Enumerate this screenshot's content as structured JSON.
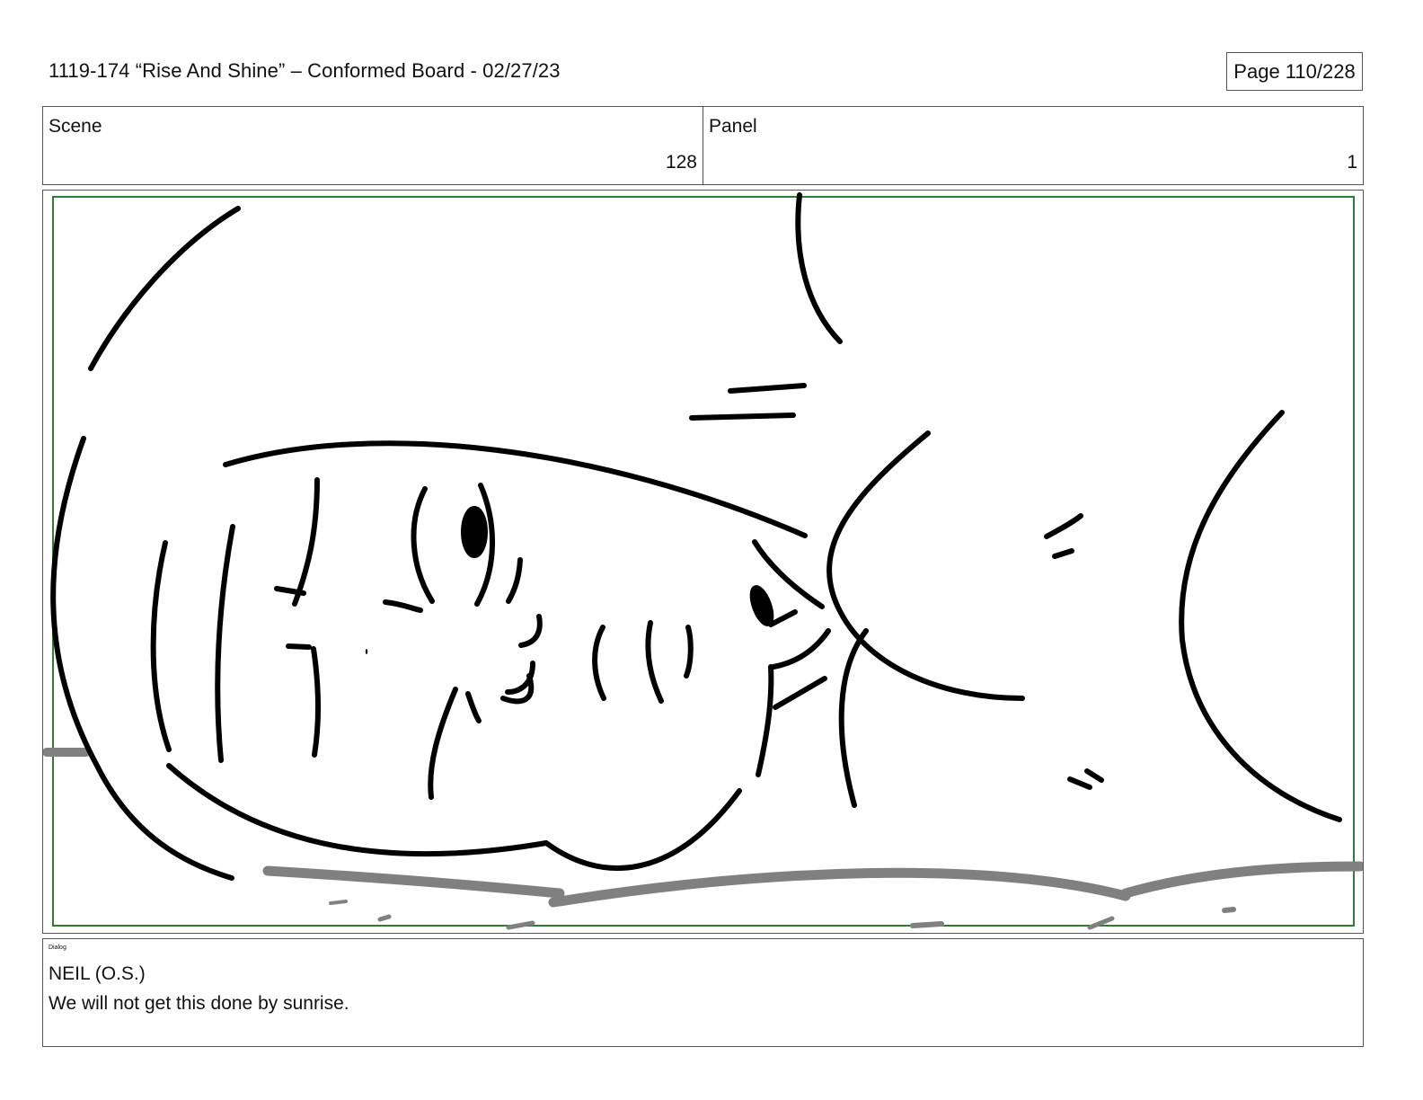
{
  "header": {
    "title": "1119-174 “Rise And Shine” – Conformed Board - 02/27/23",
    "page_indicator": "Page 110/228"
  },
  "info": {
    "scene_label": "Scene",
    "scene_value": "128",
    "panel_label": "Panel",
    "panel_value": "1"
  },
  "panel": {
    "safe_frame_color": "#2e7d32",
    "ink_color": "#000000",
    "ground_color": "#808080"
  },
  "dialog": {
    "label": "Dialog",
    "speaker": "NEIL (O.S.)",
    "line": "We will not get this done by sunrise."
  }
}
